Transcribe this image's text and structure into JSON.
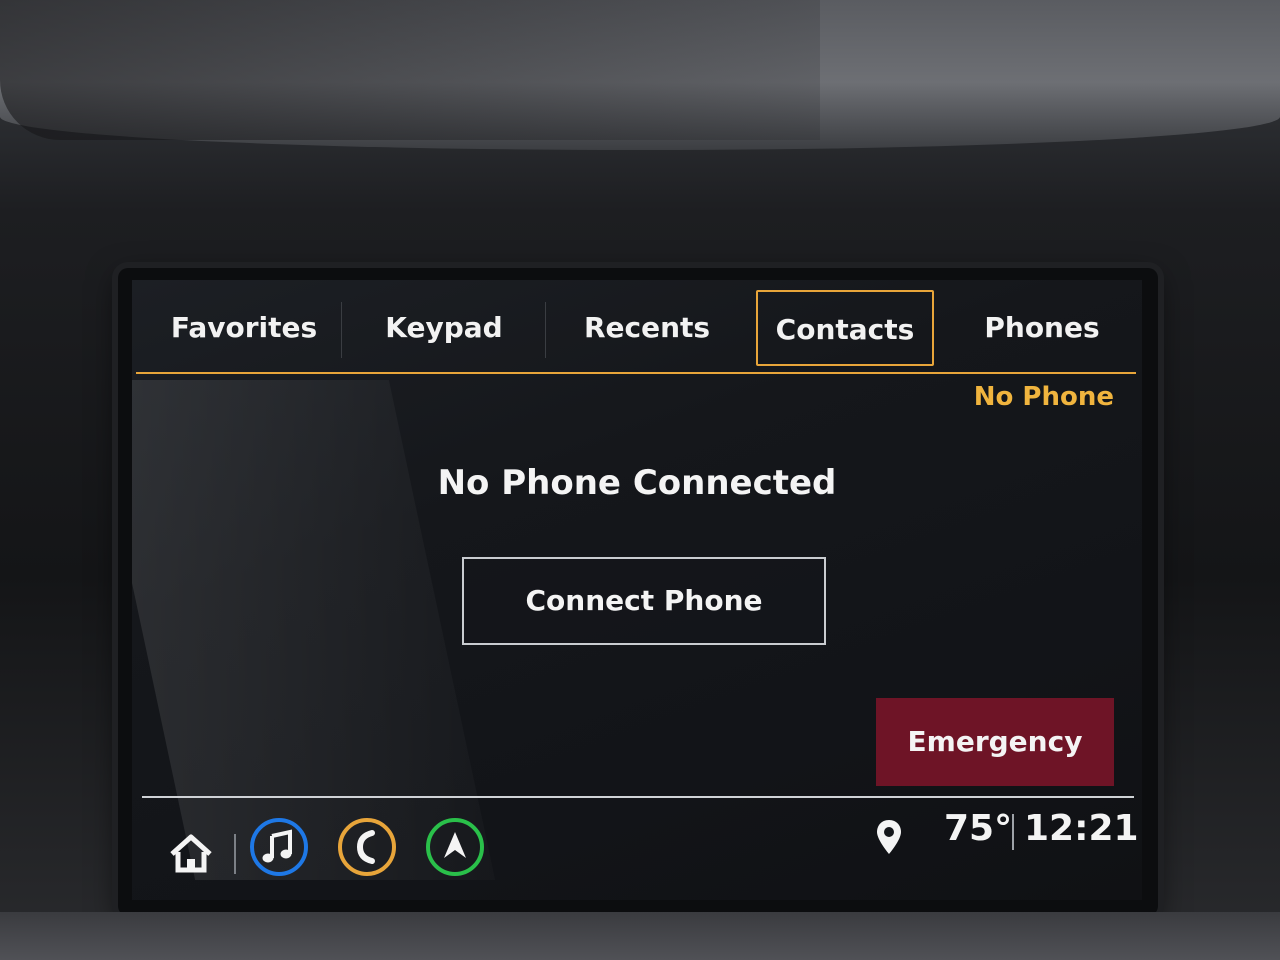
{
  "tabs": [
    {
      "label": "Favorites",
      "active": false
    },
    {
      "label": "Keypad",
      "active": false
    },
    {
      "label": "Recents",
      "active": false
    },
    {
      "label": "Contacts",
      "active": true
    },
    {
      "label": "Phones",
      "active": false
    }
  ],
  "status": {
    "phone_status": "No Phone"
  },
  "main": {
    "title": "No Phone Connected",
    "connect_button": "Connect Phone",
    "emergency_button": "Emergency"
  },
  "bottom_bar": {
    "apps": [
      {
        "name": "home-icon"
      },
      {
        "name": "music-icon",
        "color": "#1e78e6"
      },
      {
        "name": "phone-icon",
        "color": "#e8a53a"
      },
      {
        "name": "navigation-icon",
        "color": "#2ac04a"
      }
    ],
    "location_icon": "location-pin-icon",
    "temperature": "75°",
    "time": "12:21"
  },
  "colors": {
    "accent": "#e8a53a",
    "emergency": "#6e1426",
    "screen_bg": "#15171b",
    "text": "#f4f4f4"
  }
}
